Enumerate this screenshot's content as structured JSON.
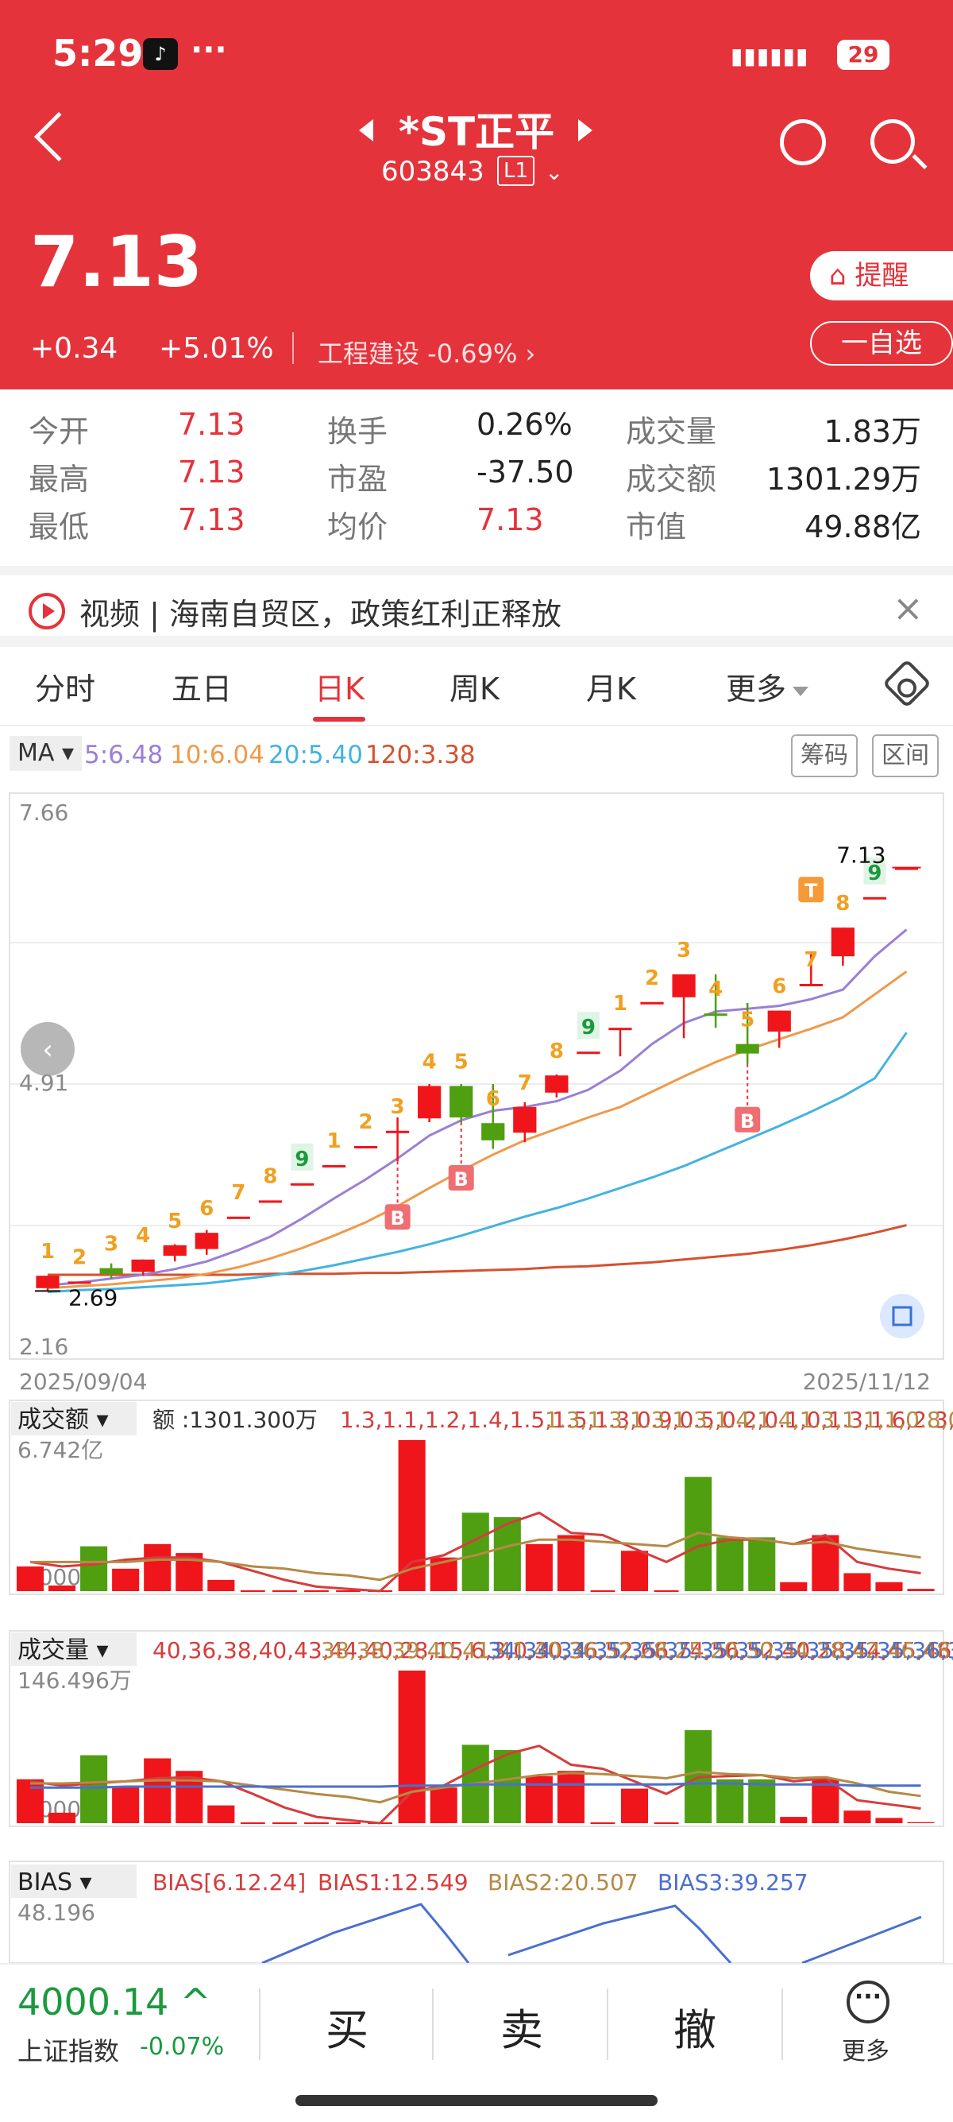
{
  "status_bar": {
    "time": "5:29",
    "notif": "···",
    "battery": "29"
  },
  "header": {
    "name": "*ST正平",
    "code": "603843",
    "level": "L1",
    "price": "7.13",
    "change": "+0.34",
    "change_pct": "+5.01%",
    "sector": "工程建设  -0.69% ›",
    "alert_label": "提醒",
    "watchlist_label": "一自选"
  },
  "quotes": {
    "open_label": "今开",
    "open": "7.13",
    "turnover_label": "换手",
    "turnover": "0.26%",
    "volume_label": "成交量",
    "volume": "1.83万",
    "high_label": "最高",
    "high": "7.13",
    "pe_label": "市盈",
    "pe": "-37.50",
    "amount_label": "成交额",
    "amount": "1301.29万",
    "low_label": "最低",
    "low": "7.13",
    "avg_label": "均价",
    "avg": "7.13",
    "mcap_label": "市值",
    "mcap": "49.88亿"
  },
  "news": {
    "text": "视频 | 海南自贸区，政策红利正释放"
  },
  "tabs": [
    "分时",
    "五日",
    "日K",
    "周K",
    "月K",
    "更多"
  ],
  "ma_row": {
    "btn": "MA",
    "ma5": "5:6.48",
    "ma10": "10:6.04",
    "ma20": "20:5.40",
    "ma120": "120:3.38",
    "chip_btn": "筹码",
    "range_btn": "区间"
  },
  "colors": {
    "up": "#f0151a",
    "down": "#4f9f11",
    "ma5": "#9a7fd6",
    "ma10": "#ef9a4a",
    "ma20": "#43b3e0",
    "ma120": "#d5522e"
  },
  "chart_data": {
    "type": "candlestick",
    "y_axis": {
      "top": "7.66",
      "mid": "4.91",
      "bottom": "2.16"
    },
    "date_start": "2025/09/04",
    "date_end": "2025/11/12",
    "last_price_label": "7.13",
    "low_label": "2.69",
    "candles": [
      {
        "o": 2.85,
        "c": 2.72,
        "h": 2.85,
        "l": 2.69,
        "up": true,
        "n": "1"
      },
      {
        "o": 2.79,
        "c": 2.79,
        "h": 2.79,
        "l": 2.79,
        "up": true,
        "n": "2"
      },
      {
        "o": 2.93,
        "c": 2.87,
        "h": 2.98,
        "l": 2.82,
        "up": false,
        "n": "3"
      },
      {
        "o": 2.89,
        "c": 3.02,
        "h": 3.02,
        "l": 2.85,
        "up": true,
        "n": "4"
      },
      {
        "o": 3.06,
        "c": 3.17,
        "h": 3.18,
        "l": 3.0,
        "up": true,
        "n": "5"
      },
      {
        "o": 3.13,
        "c": 3.3,
        "h": 3.33,
        "l": 3.07,
        "up": true,
        "n": "6"
      },
      {
        "o": 3.47,
        "c": 3.47,
        "h": 3.47,
        "l": 3.47,
        "up": true,
        "n": "7"
      },
      {
        "o": 3.64,
        "c": 3.64,
        "h": 3.64,
        "l": 3.64,
        "up": true,
        "n": "8"
      },
      {
        "o": 3.82,
        "c": 3.82,
        "h": 3.82,
        "l": 3.82,
        "up": true,
        "n": "9",
        "green": true
      },
      {
        "o": 4.01,
        "c": 4.01,
        "h": 4.01,
        "l": 4.01,
        "up": true,
        "n": "1"
      },
      {
        "o": 4.21,
        "c": 4.21,
        "h": 4.21,
        "l": 4.21,
        "up": true,
        "n": "2"
      },
      {
        "o": 4.37,
        "c": 4.37,
        "h": 4.51,
        "l": 4.05,
        "up": true,
        "n": "3"
      },
      {
        "o": 4.5,
        "c": 4.84,
        "h": 4.86,
        "l": 4.46,
        "up": true,
        "n": "4"
      },
      {
        "o": 4.84,
        "c": 4.51,
        "h": 4.86,
        "l": 4.46,
        "up": false,
        "n": "5"
      },
      {
        "o": 4.45,
        "c": 4.27,
        "h": 4.86,
        "l": 4.18,
        "up": false,
        "n": "6"
      },
      {
        "o": 4.35,
        "c": 4.62,
        "h": 4.67,
        "l": 4.25,
        "up": true,
        "n": "7"
      },
      {
        "o": 4.77,
        "c": 4.95,
        "h": 4.96,
        "l": 4.72,
        "up": true,
        "n": "8"
      },
      {
        "o": 5.2,
        "c": 5.2,
        "h": 5.2,
        "l": 5.2,
        "up": true,
        "n": "9",
        "green": true
      },
      {
        "o": 5.45,
        "c": 5.45,
        "h": 5.45,
        "l": 5.15,
        "up": true,
        "n": "1"
      },
      {
        "o": 5.72,
        "c": 5.72,
        "h": 5.72,
        "l": 5.72,
        "up": true,
        "n": "2"
      },
      {
        "o": 5.77,
        "c": 6.01,
        "h": 6.01,
        "l": 5.34,
        "up": true,
        "n": "3"
      },
      {
        "o": 5.6,
        "c": 5.6,
        "h": 6.01,
        "l": 5.45,
        "up": false,
        "n": "4"
      },
      {
        "o": 5.28,
        "c": 5.18,
        "h": 5.71,
        "l": 5.07,
        "up": false,
        "n": "5"
      },
      {
        "o": 5.41,
        "c": 5.63,
        "h": 5.63,
        "l": 5.24,
        "up": true,
        "n": "6"
      },
      {
        "o": 5.91,
        "c": 5.91,
        "h": 6.25,
        "l": 5.91,
        "up": true,
        "n": "7"
      },
      {
        "o": 6.2,
        "c": 6.5,
        "h": 6.5,
        "l": 6.1,
        "up": true,
        "n": "8"
      },
      {
        "o": 6.82,
        "c": 6.82,
        "h": 6.82,
        "l": 6.82,
        "up": true,
        "n": "9",
        "green": true
      },
      {
        "o": 7.13,
        "c": 7.13,
        "h": 7.13,
        "l": 7.13,
        "up": true,
        "n": ""
      }
    ],
    "ma5": [
      2.75,
      2.78,
      2.82,
      2.86,
      2.92,
      3.0,
      3.12,
      3.26,
      3.45,
      3.66,
      3.86,
      4.08,
      4.32,
      4.48,
      4.58,
      4.62,
      4.68,
      4.8,
      5.0,
      5.28,
      5.5,
      5.62,
      5.65,
      5.68,
      5.75,
      5.85,
      6.2,
      6.48
    ],
    "ma10": [
      2.72,
      2.74,
      2.76,
      2.79,
      2.82,
      2.87,
      2.94,
      3.03,
      3.14,
      3.27,
      3.41,
      3.58,
      3.77,
      3.95,
      4.12,
      4.27,
      4.39,
      4.51,
      4.62,
      4.78,
      4.94,
      5.09,
      5.22,
      5.33,
      5.44,
      5.56,
      5.8,
      6.04
    ],
    "ma20": [
      2.68,
      2.7,
      2.71,
      2.73,
      2.75,
      2.77,
      2.81,
      2.85,
      2.9,
      2.96,
      3.03,
      3.1,
      3.18,
      3.27,
      3.37,
      3.47,
      3.56,
      3.66,
      3.77,
      3.88,
      4.0,
      4.14,
      4.28,
      4.42,
      4.57,
      4.73,
      4.92,
      5.4
    ],
    "ma120": [
      2.86,
      2.86,
      2.86,
      2.86,
      2.86,
      2.86,
      2.86,
      2.87,
      2.87,
      2.87,
      2.88,
      2.88,
      2.89,
      2.9,
      2.91,
      2.92,
      2.94,
      2.95,
      2.97,
      2.99,
      3.02,
      3.05,
      3.08,
      3.12,
      3.17,
      3.23,
      3.3,
      3.38
    ],
    "markers": [
      {
        "i": 11,
        "type": "B"
      },
      {
        "i": 13,
        "type": "B"
      },
      {
        "i": 22,
        "type": "B"
      },
      {
        "i": 24,
        "type": "T"
      }
    ],
    "amount": {
      "label": "成交额",
      "cur": "额 :1301.300万",
      "ma5": [
        1.3,
        1.1,
        1.2,
        1.4,
        1.5,
        1.5,
        1.3,
        0.9,
        0.5,
        0.2,
        0.1,
        0,
        1.3,
        1.6,
        2.3,
        3.0,
        3.5,
        2.6,
        2.5,
        1.9,
        1.3,
        2.0,
        2.3,
        2.3,
        2.1,
        2.5,
        1.3,
        1.0,
        0.8
      ],
      "ma10": [
        1.3,
        1.3,
        1.3,
        1.3,
        1.4,
        1.4,
        1.3,
        1.1,
        1.0,
        0.8,
        0.7,
        0.5,
        1.0,
        1.3,
        1.6,
        2.0,
        2.3,
        2.3,
        2.2,
        2.1,
        2.0,
        2.6,
        2.4,
        2.3,
        2.1,
        2.2,
        1.9,
        1.7,
        1.5
      ],
      "max": "6.742亿",
      "zero": "0.000",
      "values": [
        1.1,
        0.25,
        2.0,
        1.0,
        2.1,
        1.7,
        0.5,
        0,
        0,
        0,
        0,
        0,
        6.742,
        1.5,
        3.5,
        3.3,
        2.1,
        2.5,
        0,
        1.8,
        0,
        5.1,
        2.4,
        2.4,
        0.4,
        2.5,
        0.8,
        0.4,
        0.1
      ],
      "up": [
        true,
        true,
        false,
        true,
        true,
        true,
        true,
        true,
        true,
        true,
        true,
        true,
        true,
        true,
        false,
        false,
        true,
        true,
        true,
        true,
        true,
        false,
        false,
        false,
        true,
        true,
        true,
        true,
        true
      ]
    },
    "volume": {
      "label": "成交量",
      "ma5": [
        40,
        36,
        38,
        40,
        43,
        44,
        40,
        28,
        15,
        6,
        3,
        0,
        30,
        36,
        52,
        66,
        74,
        56,
        52,
        40,
        28,
        44,
        45,
        46,
        40,
        43,
        22,
        18,
        14
      ],
      "ma10": [
        38,
        38,
        39,
        40,
        41,
        41,
        40,
        36,
        32,
        28,
        25,
        20,
        30,
        34,
        38,
        42,
        46,
        48,
        47,
        45,
        43,
        49,
        47,
        46,
        43,
        44,
        38,
        30,
        26
      ],
      "ma20": [
        34,
        34,
        34,
        35,
        35,
        35,
        35,
        35,
        35,
        35,
        35,
        35,
        36,
        36,
        37,
        37,
        37,
        37,
        37,
        37,
        37,
        38,
        38,
        37,
        37,
        37,
        36,
        36,
        36
      ],
      "max": "146.496万",
      "zero": "0.000",
      "values": [
        42,
        10,
        65,
        34,
        62,
        50,
        17,
        0,
        0,
        0,
        0,
        0,
        146,
        34,
        75,
        70,
        45,
        50,
        0,
        33,
        0,
        89,
        42,
        42,
        6,
        42,
        12,
        5,
        1
      ],
      "up": [
        true,
        true,
        false,
        true,
        true,
        true,
        true,
        true,
        true,
        true,
        true,
        true,
        true,
        true,
        false,
        false,
        true,
        true,
        true,
        true,
        true,
        false,
        false,
        false,
        true,
        true,
        true,
        true,
        true
      ]
    },
    "bias": {
      "label": "BIAS",
      "params": "BIAS[6.12.24]",
      "b1": "BIAS1:12.549",
      "b2": "BIAS2:20.507",
      "b3": "BIAS3:39.257",
      "max": "48.196"
    }
  },
  "bottom": {
    "index_value": "4000.14",
    "index_arrow": "^",
    "index_name": "上证指数",
    "index_change": "-0.07%",
    "buy": "买",
    "sell": "卖",
    "cancel": "撤",
    "more": "更多"
  }
}
